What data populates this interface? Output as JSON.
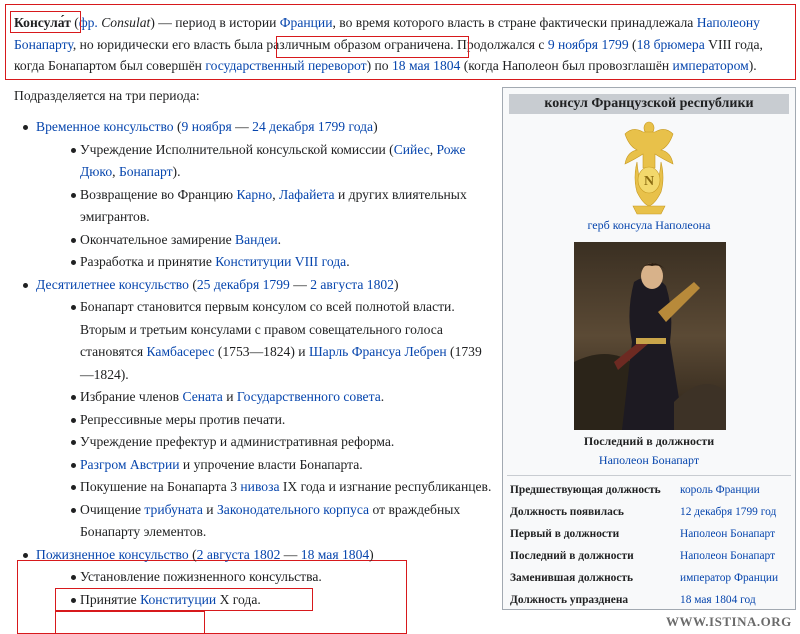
{
  "intro": {
    "term": "Консула́т",
    "abbr": "фр.",
    "foreign": "Consulat",
    "t1": " — период в истории ",
    "l_france": "Франции",
    "t2": ", во время которого власть в стране фактически принадлежала ",
    "l_napoleon": "Наполеону Бонапарту",
    "t3": ", ",
    "limited": "но юридически его власть была различным образом ограничена",
    "t4": ". Продолжался с ",
    "l_9nov": "9 ноября 1799",
    "l_brumaire": "18 брюмера",
    "t5": " VIII года, когда Бонапартом был совершён ",
    "l_coup": "государственный переворот",
    "t6": ") по ",
    "l_18may": "18 мая 1804",
    "t7": " (когда Наполеон был провозглашён ",
    "l_emperor": "императором",
    "t8": ")."
  },
  "periods_heading": "Подразделяется на три периода:",
  "p1": {
    "l_name": "Временное консульство",
    "l_start": "9 ноября",
    "l_end": "24 декабря 1799 года",
    "i1_a": "Учреждение Исполнительной консульской комиссии (",
    "i1_l1": "Сийес",
    "i1_l2": "Роже Дюко",
    "i1_l3": "Бонапарт",
    "i1_b": ").",
    "i2_a": "Возвращение во Францию ",
    "i2_l1": "Карно",
    "i2_l2": "Лафайета",
    "i2_b": " и других влиятельных эмигрантов.",
    "i3_a": "Окончательное замирение ",
    "i3_l1": "Вандеи",
    "i3_b": ".",
    "i4_a": "Разработка и принятие ",
    "i4_l1": "Конституции VIII года",
    "i4_b": "."
  },
  "p2": {
    "l_name": "Десятилетнее консульство",
    "l_start": "25 декабря 1799",
    "l_end": "2 августа 1802",
    "i1_a": "Бонапарт становится первым консулом со всей полнотой власти. Вторым и третьим консулами с правом совещательного голоса становятся ",
    "i1_l1": "Камбасерес",
    "i1_b": " (1753—1824) и ",
    "i1_l2": "Шарль Франсуа Лебрен",
    "i1_c": " (1739—1824).",
    "i2_a": "Избрание членов ",
    "i2_l1": "Сената",
    "i2_l2": "Государственного совета",
    "i2_b": ".",
    "i3": "Репрессивные меры против печати.",
    "i4": "Учреждение префектур и административная реформа.",
    "i5_l1": "Разгром Австрии",
    "i5_b": " и упрочение власти Бонапарта.",
    "i6_a": "Покушение на Бонапарта 3 ",
    "i6_l1": "нивоза",
    "i6_b": " IX года и изгнание республиканцев.",
    "i7_a": "Очищение ",
    "i7_l1": "трибуната",
    "i7_l2": "Законодательного корпуса",
    "i7_b": " от враждебных Бонапарту элементов."
  },
  "p3": {
    "l_name": "Пожизненное консульство",
    "l_start": "2 августа 1802",
    "l_end": "18 мая 1804",
    "i1": "Установление пожизненного консульства.",
    "i2_a": "Принятие ",
    "i2_l1": "Конституции",
    "i2_b": " X года."
  },
  "words": {
    "and": " и ",
    "comma": ", ",
    "dash": " — ",
    "open": " (",
    "close": ")"
  },
  "infobox": {
    "title": "консул Французской республики",
    "coat_letter": "N",
    "coat_caption": "герб консула Наполеона",
    "last_label": "Последний в должности",
    "last_name": "Наполеон Бонапарт",
    "rows": [
      {
        "k": "Предшествующая должность",
        "v": "король Франции"
      },
      {
        "k": "Должность появилась",
        "v": "12 декабря 1799 год"
      },
      {
        "k": "Первый в должности",
        "v": "Наполеон Бонапарт"
      },
      {
        "k": "Последний в должности",
        "v": "Наполеон Бонапарт"
      },
      {
        "k": "Заменившая должность",
        "v": "император Франции"
      },
      {
        "k": "Должность упразднена",
        "v": "18 мая 1804 год"
      }
    ]
  },
  "watermark": "WWW.ISTINA.ORG",
  "colors": {
    "link": "#0645ad",
    "highlight": "#d7191c",
    "infobox_title_bg": "#c8ccd1"
  }
}
